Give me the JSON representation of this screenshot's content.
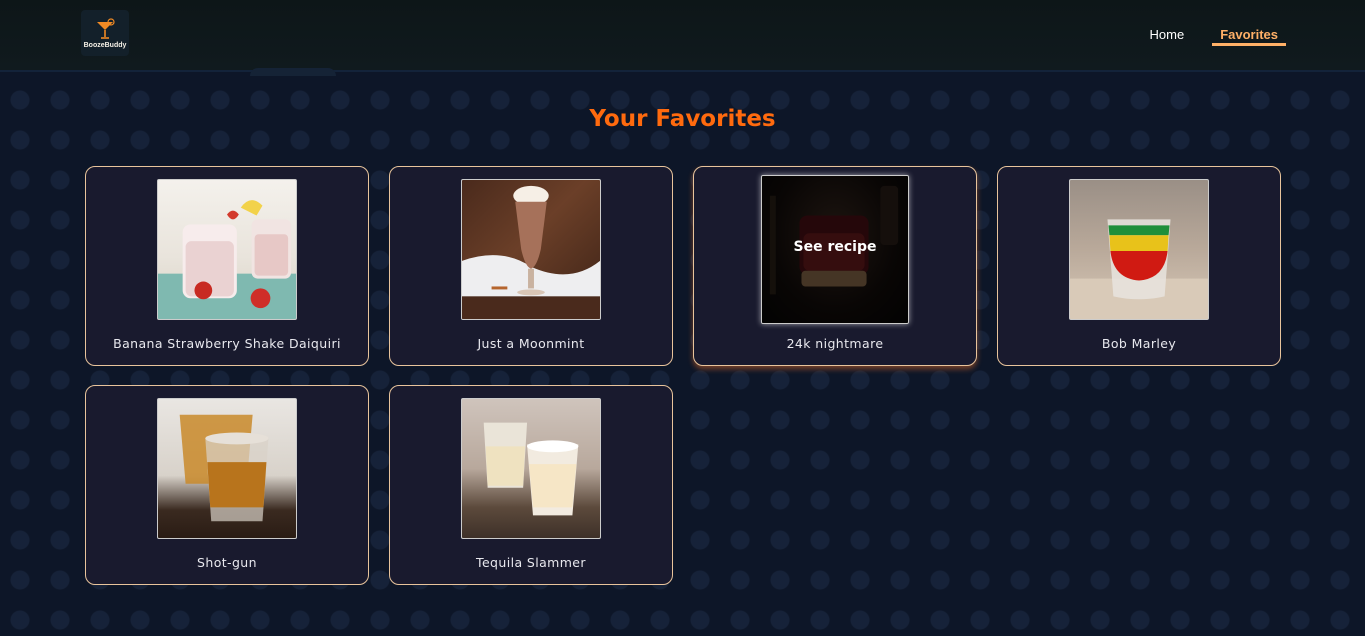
{
  "brand": {
    "name": "BoozeBuddy"
  },
  "nav": {
    "links": [
      {
        "label": "Home",
        "active": false
      },
      {
        "label": "Favorites",
        "active": true
      }
    ]
  },
  "page": {
    "title": "Your Favorites"
  },
  "favorites": [
    {
      "name": "Banana Strawberry Shake Daiquiri",
      "image": "banana-strawberry-shake-photo"
    },
    {
      "name": "Just a Moonmint",
      "image": "moonmint-hurricane-glass-photo"
    },
    {
      "name": "24k nightmare",
      "image": "24k-nightmare-shot-photo",
      "hovered": true,
      "overlay_label": "See recipe"
    },
    {
      "name": "Bob Marley",
      "image": "bob-marley-layered-shot-photo"
    },
    {
      "name": "Shot-gun",
      "image": "shot-gun-whiskey-shots-photo"
    },
    {
      "name": "Tequila Slammer",
      "image": "tequila-slammer-shots-photo"
    }
  ],
  "colors": {
    "background": "#0d1628",
    "navbar": "#0f181b",
    "accent_orange": "#ff6a0e",
    "nav_active": "#ffb067",
    "card_bg": "#191a2e",
    "card_border": "#e8c49c"
  }
}
